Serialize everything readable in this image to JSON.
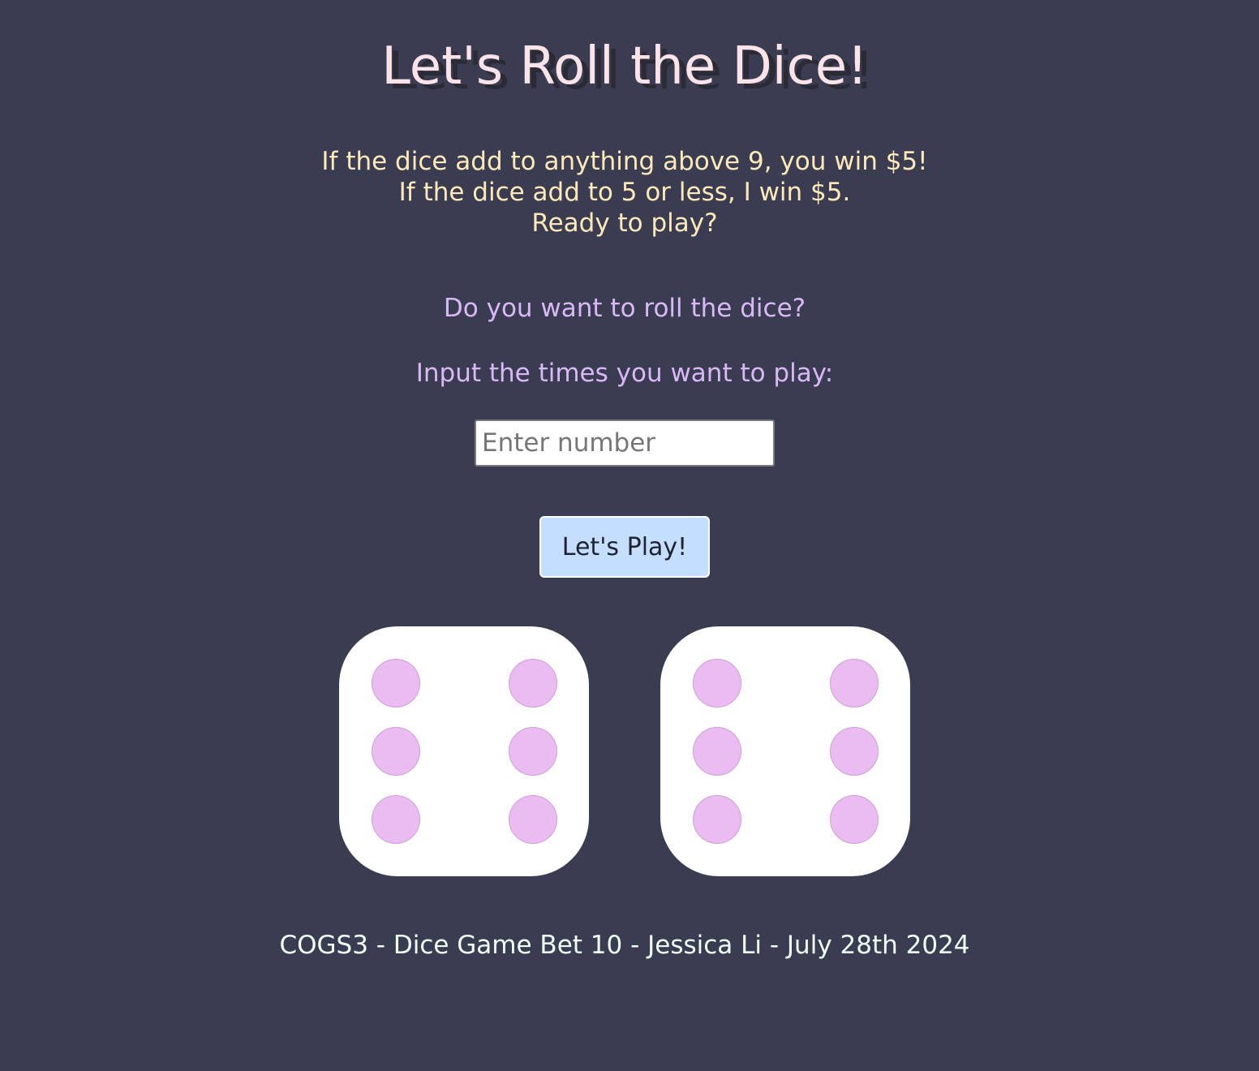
{
  "title": "Let's Roll the Dice!",
  "rules": {
    "line1": "If the dice add to anything above 9, you win $5!",
    "line2": "If the dice add to 5 or less, I win $5.",
    "line3": "Ready to play?"
  },
  "question": "Do you want to roll the dice?",
  "prompt": "Input the times you want to play:",
  "input": {
    "value": "",
    "placeholder": "Enter number"
  },
  "play_button_label": "Let's Play!",
  "dice": [
    {
      "face": 6
    },
    {
      "face": 6
    }
  ],
  "colors": {
    "background": "#3a3d52",
    "title": "#fbe3e7",
    "rules": "#ffe9b8",
    "prompt": "#d9b8f5",
    "button": "#c3deff",
    "pip": "#ebbcf2"
  },
  "footer": "COGS3 - Dice Game Bet 10 - Jessica Li - July 28th 2024"
}
